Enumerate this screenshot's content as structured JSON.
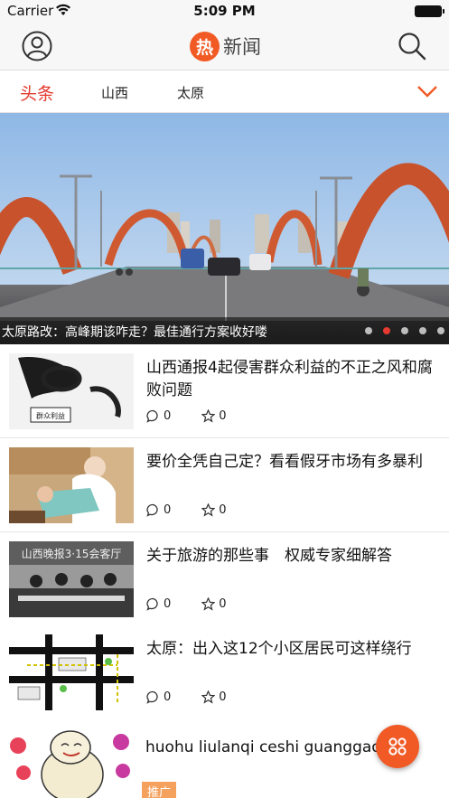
{
  "status_bar": {
    "carrier": "Carrier",
    "time": "5:09 PM"
  },
  "nav": {
    "logo_char": "热",
    "title": "新闻",
    "icons": {
      "left": "user-profile-icon",
      "right": "search-icon"
    }
  },
  "tabs": [
    {
      "label": "头条",
      "active": true
    },
    {
      "label": "山西",
      "active": false
    },
    {
      "label": "太原",
      "active": false
    }
  ],
  "hero": {
    "caption": "太原路改：高峰期该咋走？最佳通行方案收好喽",
    "slide_count": 5,
    "active_slide": 2
  },
  "news": [
    {
      "title": "山西通报4起侵害群众利益的不正之风和腐败问题",
      "comments": "0",
      "favorites": "0"
    },
    {
      "title": "要价全凭自己定？看看假牙市场有多暴利",
      "comments": "0",
      "favorites": "0"
    },
    {
      "title": "关于旅游的那些事　权威专家细解答",
      "comments": "0",
      "favorites": "0"
    },
    {
      "title": "太原：出入这12个小区居民可这样绕行",
      "comments": "0",
      "favorites": "0"
    }
  ],
  "ad": {
    "title": "huohu liulanqi ceshi guanggao",
    "tag": "推广"
  },
  "thumb_text": {
    "cartoon_label": "群众利益",
    "banner_text": "山西晚报3·15会客厅"
  },
  "colors": {
    "accent": "#e43a2f",
    "brand": "#f15a24",
    "ad_tag": "#f5a15e"
  }
}
